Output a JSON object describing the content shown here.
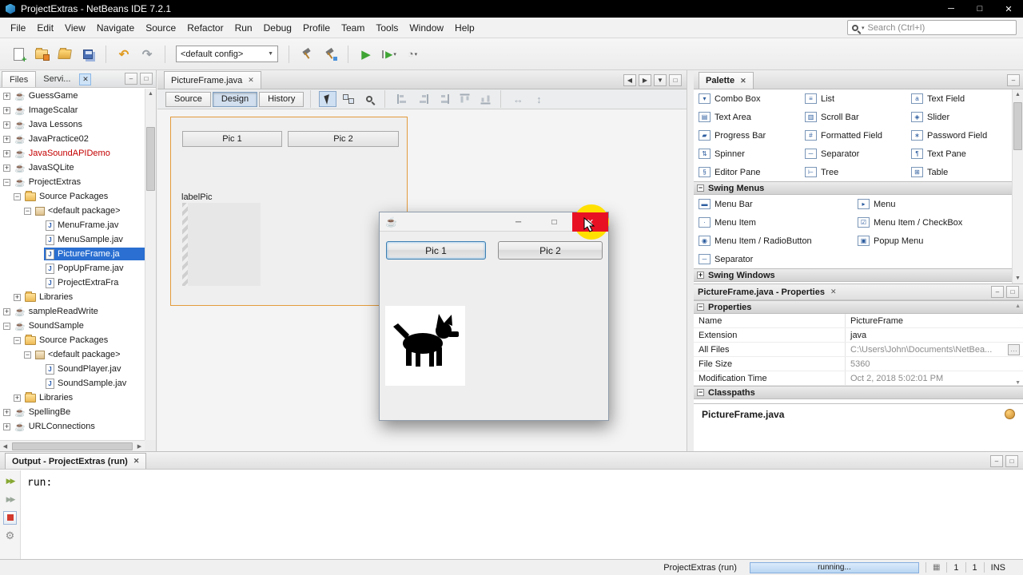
{
  "titlebar": {
    "title": "ProjectExtras - NetBeans IDE 7.2.1"
  },
  "menubar": {
    "items": [
      "File",
      "Edit",
      "View",
      "Navigate",
      "Source",
      "Refactor",
      "Run",
      "Debug",
      "Profile",
      "Team",
      "Tools",
      "Window",
      "Help"
    ],
    "search": {
      "placeholder": "Search (Ctrl+I)"
    }
  },
  "toolbar": {
    "config_selector": "<default config>"
  },
  "files_panel": {
    "tabs": [
      {
        "label": "Files"
      },
      {
        "label": "Servi..."
      }
    ],
    "tree": [
      {
        "label": "GuessGame",
        "level": 0,
        "icon": "project",
        "toggle": "collapsed"
      },
      {
        "label": "ImageScalar",
        "level": 0,
        "icon": "project",
        "toggle": "collapsed"
      },
      {
        "label": "Java Lessons",
        "level": 0,
        "icon": "project",
        "toggle": "collapsed"
      },
      {
        "label": "JavaPractice02",
        "level": 0,
        "icon": "project",
        "toggle": "collapsed"
      },
      {
        "label": "JavaSoundAPIDemo",
        "level": 0,
        "icon": "project",
        "toggle": "collapsed",
        "color": "#c40000"
      },
      {
        "label": "JavaSQLite",
        "level": 0,
        "icon": "project",
        "toggle": "collapsed"
      },
      {
        "label": "ProjectExtras",
        "level": 0,
        "icon": "project",
        "toggle": "expanded"
      },
      {
        "label": "Source Packages",
        "level": 1,
        "icon": "folder",
        "toggle": "expanded"
      },
      {
        "label": "<default package>",
        "level": 2,
        "icon": "package",
        "toggle": "expanded"
      },
      {
        "label": "MenuFrame.jav",
        "level": 3,
        "icon": "java",
        "toggle": "none"
      },
      {
        "label": "MenuSample.jav",
        "level": 3,
        "icon": "java",
        "toggle": "none"
      },
      {
        "label": "PictureFrame.ja",
        "level": 3,
        "icon": "java",
        "toggle": "none",
        "selected": true
      },
      {
        "label": "PopUpFrame.jav",
        "level": 3,
        "icon": "java",
        "toggle": "none"
      },
      {
        "label": "ProjectExtraFra",
        "level": 3,
        "icon": "java",
        "toggle": "none"
      },
      {
        "label": "Libraries",
        "level": 1,
        "icon": "folder",
        "toggle": "collapsed"
      },
      {
        "label": "sampleReadWrite",
        "level": 0,
        "icon": "project",
        "toggle": "collapsed"
      },
      {
        "label": "SoundSample",
        "level": 0,
        "icon": "project",
        "toggle": "expanded"
      },
      {
        "label": "Source Packages",
        "level": 1,
        "icon": "folder",
        "toggle": "expanded"
      },
      {
        "label": "<default package>",
        "level": 2,
        "icon": "package",
        "toggle": "expanded"
      },
      {
        "label": "SoundPlayer.jav",
        "level": 3,
        "icon": "java",
        "toggle": "none"
      },
      {
        "label": "SoundSample.jav",
        "level": 3,
        "icon": "java",
        "toggle": "none"
      },
      {
        "label": "Libraries",
        "level": 1,
        "icon": "folder",
        "toggle": "collapsed"
      },
      {
        "label": "SpellingBe",
        "level": 0,
        "icon": "project",
        "toggle": "collapsed"
      },
      {
        "label": "URLConnections",
        "level": 0,
        "icon": "project",
        "toggle": "collapsed"
      }
    ]
  },
  "editor": {
    "tab_label": "PictureFrame.java",
    "views": [
      {
        "label": "Source"
      },
      {
        "label": "Design",
        "active": true
      },
      {
        "label": "History"
      }
    ],
    "design": {
      "buttons": [
        "Pic 1",
        "Pic 2"
      ],
      "label_text": "labelPic"
    }
  },
  "app_window": {
    "buttons": [
      "Pic 1",
      "Pic 2"
    ]
  },
  "palette": {
    "tab_title": "Palette",
    "controls": [
      {
        "label": "Combo Box",
        "icon": "combo-box"
      },
      {
        "label": "List",
        "icon": "list"
      },
      {
        "label": "Text Field",
        "icon": "text-field"
      },
      {
        "label": "Text Area",
        "icon": "text-area"
      },
      {
        "label": "Scroll Bar",
        "icon": "scroll-bar"
      },
      {
        "label": "Slider",
        "icon": "slider"
      },
      {
        "label": "Progress Bar",
        "icon": "progress-bar"
      },
      {
        "label": "Formatted Field",
        "icon": "formatted-field"
      },
      {
        "label": "Password Field",
        "icon": "password-field"
      },
      {
        "label": "Spinner",
        "icon": "spinner"
      },
      {
        "label": "Separator",
        "icon": "separator"
      },
      {
        "label": "Text Pane",
        "icon": "text-pane"
      },
      {
        "label": "Editor Pane",
        "icon": "editor-pane"
      },
      {
        "label": "Tree",
        "icon": "tree"
      },
      {
        "label": "Table",
        "icon": "table"
      }
    ],
    "sections": [
      {
        "title": "Swing Menus",
        "expanded": true,
        "items": [
          {
            "label": "Menu Bar",
            "icon": "menu-bar"
          },
          {
            "label": "Menu",
            "icon": "menu"
          },
          {
            "label": "Menu Item",
            "icon": "menu-item"
          },
          {
            "label": "Menu Item / CheckBox",
            "icon": "menu-item-checkbox"
          },
          {
            "label": "Menu Item / RadioButton",
            "icon": "menu-item-radiobutton"
          },
          {
            "label": "Popup Menu",
            "icon": "popup-menu"
          },
          {
            "label": "Separator",
            "icon": "separator"
          }
        ]
      },
      {
        "title": "Swing Windows",
        "expanded": false,
        "items": []
      }
    ]
  },
  "properties": {
    "title": "PictureFrame.java - Properties",
    "sections": [
      {
        "title": "Properties"
      },
      {
        "title": "Classpaths"
      }
    ],
    "rows": [
      {
        "name": "Name",
        "value": "PictureFrame",
        "muted": false
      },
      {
        "name": "Extension",
        "value": "java",
        "muted": false
      },
      {
        "name": "All Files",
        "value": "C:\\Users\\John\\Documents\\NetBea...",
        "muted": true,
        "has_more": true
      },
      {
        "name": "File Size",
        "value": "5360",
        "muted": true
      },
      {
        "name": "Modification Time",
        "value": "Oct 2, 2018 5:02:01 PM",
        "muted": true
      }
    ],
    "footer": "PictureFrame.java"
  },
  "output": {
    "tab": "Output - ProjectExtras (run)",
    "console_text": "run:"
  },
  "statusbar": {
    "project_label": "ProjectExtras (run)",
    "progress_label": "running...",
    "line": "1",
    "column": "1",
    "mode": "INS"
  }
}
